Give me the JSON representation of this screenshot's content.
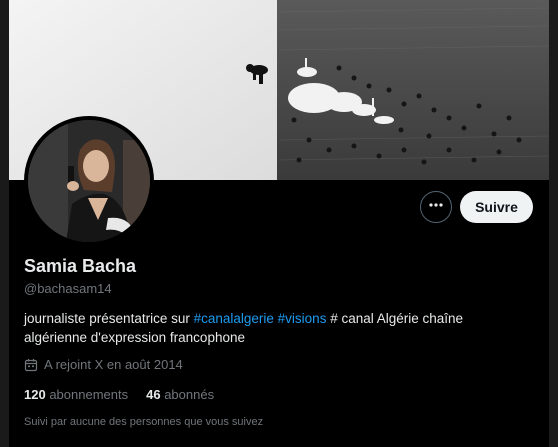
{
  "profile": {
    "name": "Samia Bacha",
    "handle": "@bachasam14",
    "bio": {
      "before": "journaliste présentatrice sur ",
      "tag1": "#canalalgerie",
      "space": " ",
      "tag2": "#visions",
      "after": " # canal Algérie chaîne algérienne d'expression francophone"
    },
    "joined": "A rejoint X en août 2014",
    "stats": {
      "following_count": "120",
      "following_label": "abonnements",
      "followers_count": "46",
      "followers_label": "abonnés"
    },
    "followed_by": "Suivi par aucune des personnes que vous suivez"
  },
  "actions": {
    "follow_label": "Suivre"
  },
  "icons": {
    "more": "more-horizontal-icon",
    "calendar": "calendar-icon"
  },
  "colors": {
    "background": "#000000",
    "link": "#1d9bf0",
    "secondary_text": "#71767b",
    "follow_button_bg": "#eff3f4"
  }
}
